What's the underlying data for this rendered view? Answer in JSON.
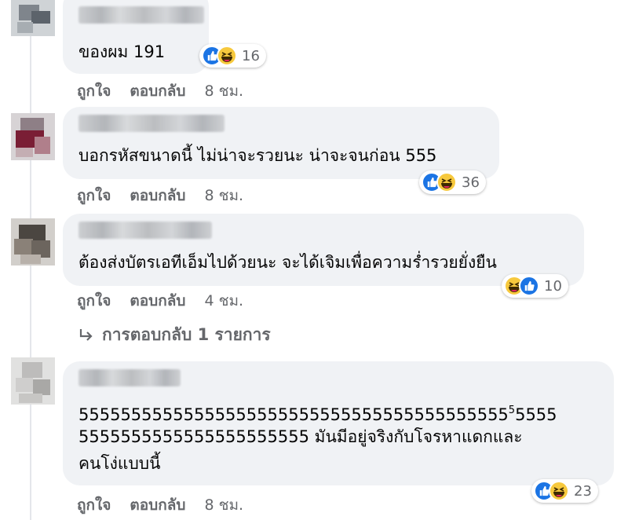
{
  "comments": [
    {
      "text": "ของผม 191",
      "reactions": {
        "icons": [
          "like",
          "haha"
        ],
        "count": "16"
      },
      "actions": {
        "like": "ถูกใจ",
        "reply": "ตอบกลับ",
        "time": "8 ชม."
      }
    },
    {
      "text": "บอกรหัสขนาดนี้ ไม่น่าจะรวยนะ น่าจะจนก่อน 555",
      "reactions": {
        "icons": [
          "like",
          "haha"
        ],
        "count": "36"
      },
      "actions": {
        "like": "ถูกใจ",
        "reply": "ตอบกลับ",
        "time": "8 ชม."
      }
    },
    {
      "text": "ต้องส่งบัตรเอทีเอ็มไปด้วยนะ จะได้เจิมเพื่อความร่ำรวยยั่งยืน",
      "reactions": {
        "icons": [
          "haha",
          "like"
        ],
        "count": "10"
      },
      "actions": {
        "like": "ถูกใจ",
        "reply": "ตอบกลับ",
        "time": "4 ชม."
      },
      "replies_link": "การตอบกลับ 1 รายการ"
    },
    {
      "text_line1": "55555555555555555555555555555555555555555",
      "text_line1_sup": "5",
      "text_line1_tail": "5555",
      "text_line2": "5555555555555555555555 มันมีอยู่จริงกับโจรหาแดกและ",
      "text_line3": "คนโง่แบบนี้",
      "reactions": {
        "icons": [
          "like",
          "haha"
        ],
        "count": "23"
      },
      "actions": {
        "like": "ถูกใจ",
        "reply": "ตอบกลับ",
        "time": "8 ชม."
      }
    }
  ],
  "colors": {
    "bubble": "#f0f2f5",
    "meta_text": "#65676b",
    "like_blue": "#1b74e4",
    "haha_yellow": "#f7c93d"
  }
}
